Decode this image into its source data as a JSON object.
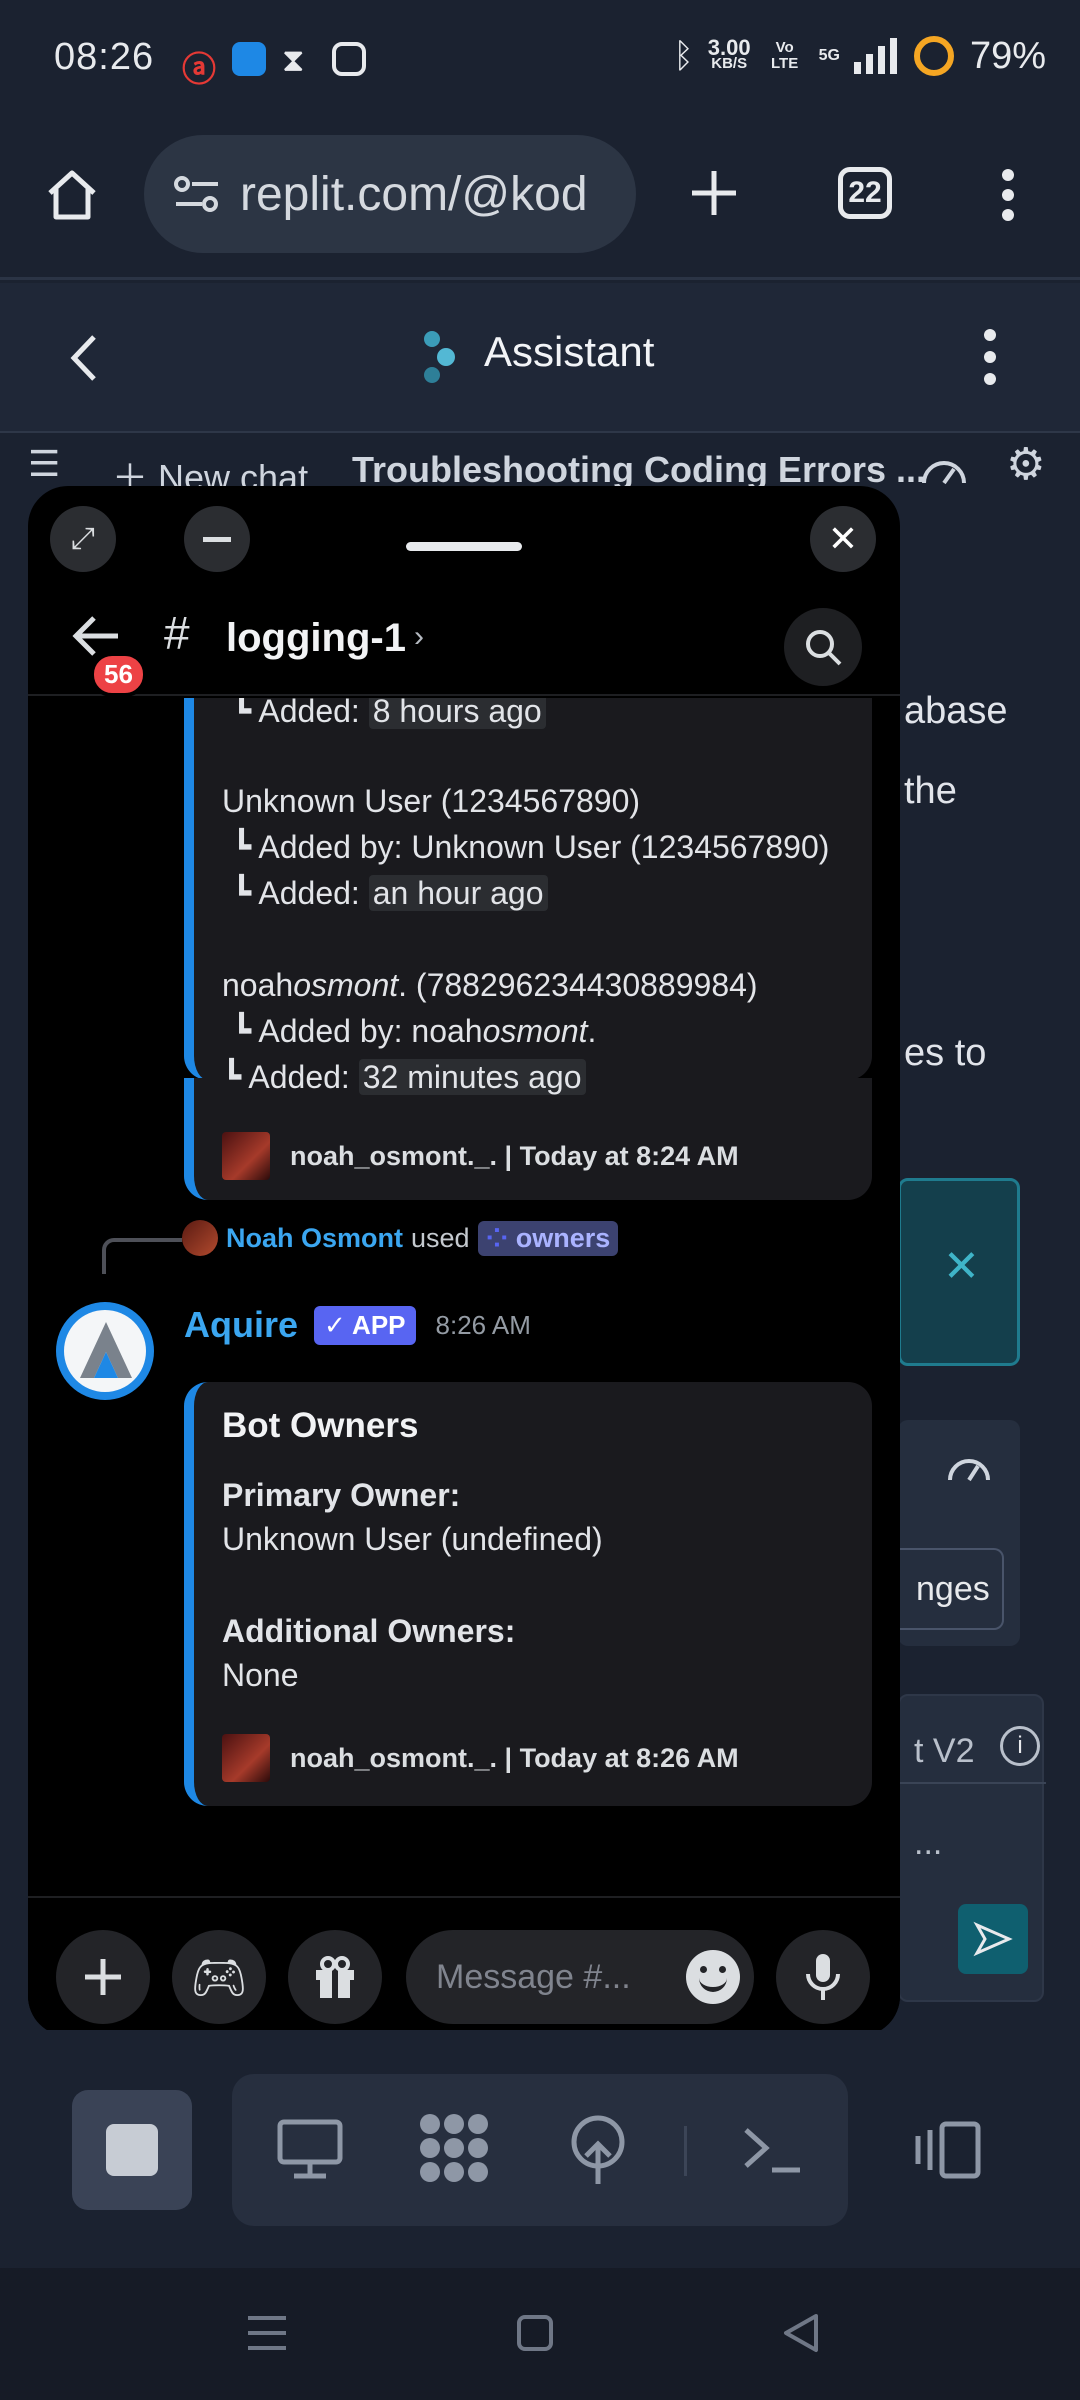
{
  "status_bar": {
    "time": "08:26",
    "net_speed": "3.00",
    "net_unit": "KB/S",
    "volte": "Vo LTE",
    "signal": "5G",
    "battery": "79%"
  },
  "browser": {
    "url": "replit.com/@kod",
    "tab_count": "22"
  },
  "assistant": {
    "title": "Assistant",
    "new_chat": "New chat",
    "chat_title": "Troubleshooting Coding Errors ..."
  },
  "background_text": {
    "line1": "abase",
    "line2": "the",
    "line3": "es to",
    "changes": "nges",
    "agent": "t V2",
    "ellipsis": "..."
  },
  "discord": {
    "channel": "logging-1",
    "unread_badge": "56",
    "embed1": {
      "line_added_1_prefix": "┗ Added: ",
      "line_added_1_time": "8 hours ago",
      "user2": "Unknown User (1234567890)",
      "user2_added_by": "┗ Added by: Unknown User (1234567890)",
      "user2_added_prefix": "┗ Added: ",
      "user2_added_time": "an hour ago",
      "user3_a": "noah",
      "user3_b": "osmont",
      "user3_c": ". (788296234430889984)",
      "user3_added_by_prefix": "┗ Added by: noah",
      "user3_added_by_italic": "osmont",
      "user3_added_by_suffix": ".",
      "user3_added_prefix": "┗ Added: ",
      "user3_added_time": "32 minutes ago",
      "footer": "noah_osmont._. | Today at 8:24 AM"
    },
    "reply": {
      "user": "Noah Osmont",
      "used": "used",
      "command": "owners"
    },
    "message": {
      "author": "Aquire",
      "app_tag": "✓ APP",
      "time": "8:26 AM"
    },
    "embed2": {
      "title": "Bot Owners",
      "primary_label": "Primary Owner:",
      "primary_value": "Unknown User (undefined)",
      "additional_label": "Additional Owners:",
      "additional_value": "None",
      "footer": "noah_osmont._. | Today at 8:26 AM"
    },
    "composer_placeholder": "Message #..."
  }
}
